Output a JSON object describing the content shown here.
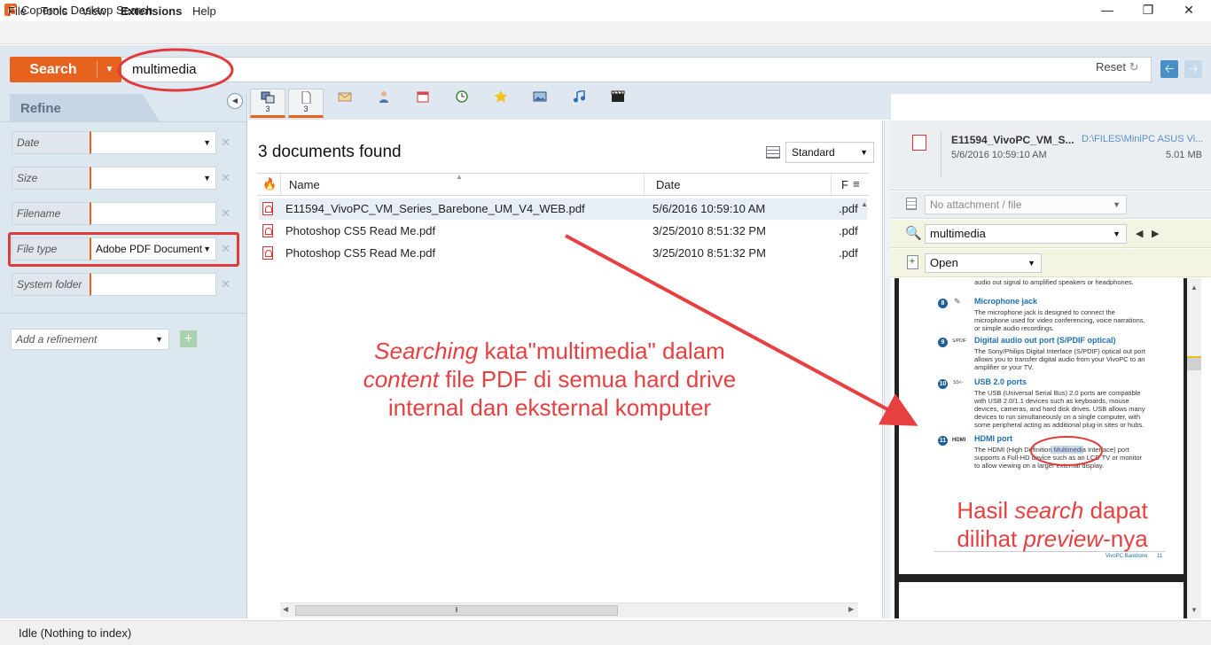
{
  "window": {
    "title": "Copernic Desktop Search"
  },
  "menu": [
    "File",
    "Tools",
    "View",
    "Extensions",
    "Help"
  ],
  "search": {
    "button_label": "Search",
    "query": "multimedia",
    "reset_label": "Reset"
  },
  "refine": {
    "title": "Refine",
    "filters": [
      {
        "label": "Date",
        "value": ""
      },
      {
        "label": "Size",
        "value": ""
      },
      {
        "label": "Filename",
        "value": ""
      },
      {
        "label": "File type",
        "value": "Adobe PDF Document"
      },
      {
        "label": "System folder",
        "value": ""
      }
    ],
    "add_placeholder": "Add a refinement"
  },
  "categories": [
    {
      "icon": "all-results-icon",
      "count": "3"
    },
    {
      "icon": "files-icon",
      "count": "3"
    },
    {
      "icon": "email-icon",
      "count": ""
    },
    {
      "icon": "contacts-icon",
      "count": ""
    },
    {
      "icon": "calendar-icon",
      "count": ""
    },
    {
      "icon": "history-icon",
      "count": ""
    },
    {
      "icon": "favorites-icon",
      "count": ""
    },
    {
      "icon": "pictures-icon",
      "count": ""
    },
    {
      "icon": "music-icon",
      "count": ""
    },
    {
      "icon": "videos-icon",
      "count": ""
    }
  ],
  "results": {
    "summary": "3 documents found",
    "view_mode": "Standard",
    "columns": [
      "Name",
      "Date",
      "F"
    ],
    "rows": [
      {
        "name": "E11594_VivoPC_VM_Series_Barebone_UM_V4_WEB.pdf",
        "date": "5/6/2016 10:59:10 AM",
        "ext": ".pdf"
      },
      {
        "name": "Photoshop CS5 Read Me.pdf",
        "date": "3/25/2010 8:51:32 PM",
        "ext": ".pdf"
      },
      {
        "name": "Photoshop CS5 Read Me.pdf",
        "date": "3/25/2010 8:51:32 PM",
        "ext": ".pdf"
      }
    ]
  },
  "preview": {
    "filename": "E11594_VivoPC_VM_S...",
    "path": "D:\\FILES\\MiniPC ASUS Vi...",
    "date": "5/6/2016 10:59:10 AM",
    "size": "5.01 MB",
    "attachment": "No attachment / file",
    "keyword": "multimedia",
    "open_label": "Open",
    "doc": {
      "top_line": "audio out signal to amplified speakers or headphones.",
      "items": [
        {
          "num": "8",
          "title": "Microphone jack",
          "text": "The microphone jack is designed to connect the microphone used for video conferencing, voice narrations, or simple audio recordings."
        },
        {
          "num": "9",
          "title": "Digital audio out port (S/PDIF optical)",
          "text": "The Sony/Philips Digital Interface (S/PDIF) optical out port allows you to transfer digital audio from your VivoPC to an amplifier or your TV."
        },
        {
          "num": "10",
          "title": "USB 2.0 ports",
          "text": "The USB (Universal Serial Bus) 2.0 ports are compatible with USB 2.0/1.1 devices such as keyboards, mouse devices, cameras, and hard disk drives. USB allows many devices to run simultaneously on a single computer, with some peripheral acting as additional plug-in sites or hubs."
        },
        {
          "num": "11",
          "title": "HDMI port",
          "text": "The HDMI (High Definition Multimedia Interface) port supports a Full-HD device such as an LCD TV or monitor to allow viewing on a larger external display."
        }
      ],
      "icon_labels": [
        "S/PDIF",
        "SS<-",
        "HDMI"
      ],
      "footer": "VivoPC Barebone",
      "page": "11"
    }
  },
  "annotations": {
    "left": {
      "line1_em": "Searching",
      "line1": " kata\"multimedia\" dalam",
      "line2_em": "content",
      "line2": " file PDF di semua hard drive",
      "line3": "internal dan eksternal komputer"
    },
    "right": {
      "line1": "Hasil ",
      "line1_em": "search",
      "line1_end": " dapat",
      "line2": "dilihat ",
      "line2_em": "preview",
      "line2_end": "-nya"
    }
  },
  "status": "Idle (Nothing to index)",
  "colors": {
    "accent": "#e8621f",
    "annotation": "#e84040",
    "nav": "#4a8ec6"
  }
}
